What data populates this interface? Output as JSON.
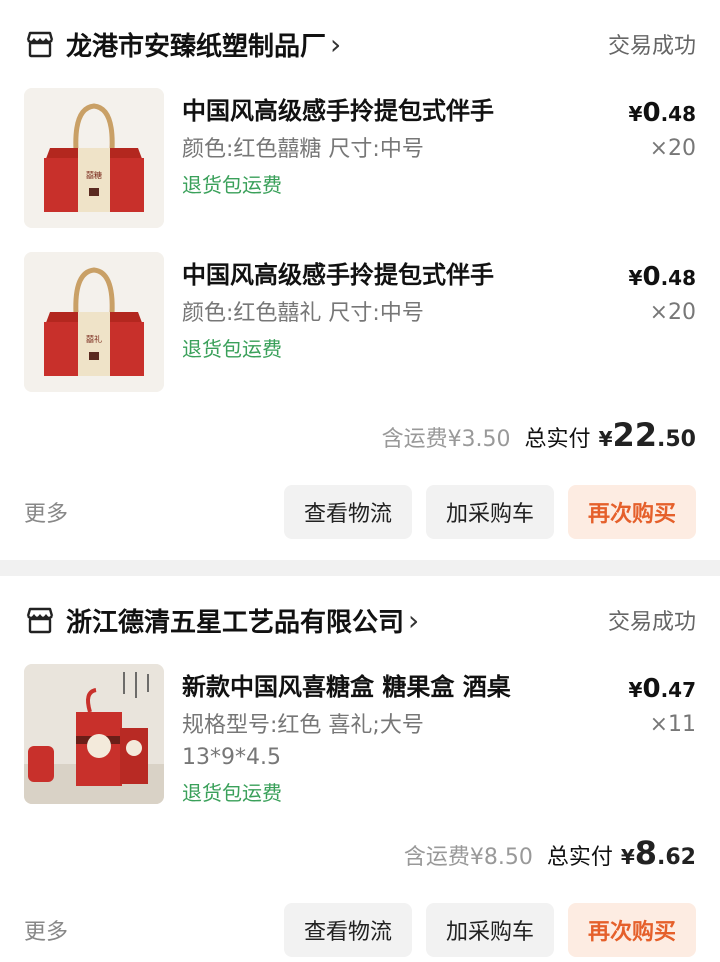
{
  "orders": [
    {
      "shop_name": "龙港市安臻纸塑制品厂",
      "status": "交易成功",
      "items": [
        {
          "title": "中国风高级感手拎提包式伴手",
          "spec": "颜色:红色囍糖 尺寸:中号",
          "return_policy": "退货包运费",
          "price_symbol": "¥",
          "price_int": "0",
          "price_dec": ".48",
          "qty": "×20",
          "label_text": "囍糖"
        },
        {
          "title": "中国风高级感手拎提包式伴手",
          "spec": "颜色:红色囍礼 尺寸:中号",
          "return_policy": "退货包运费",
          "price_symbol": "¥",
          "price_int": "0",
          "price_dec": ".48",
          "qty": "×20",
          "label_text": "囍礼"
        }
      ],
      "shipping": "含运费¥3.50",
      "total_label": "总实付",
      "total_symbol": "¥",
      "total_int": "22",
      "total_dec": ".50",
      "more": "更多",
      "buttons": {
        "logistics": "查看物流",
        "add_cart": "加采购车",
        "buy_again": "再次购买"
      }
    },
    {
      "shop_name": "浙江德清五星工艺品有限公司",
      "status": "交易成功",
      "items": [
        {
          "title": "新款中国风喜糖盒 糖果盒 酒桌",
          "spec": "规格型号:红色 喜礼;大号 13*9*4.5",
          "return_policy": "退货包运费",
          "price_symbol": "¥",
          "price_int": "0",
          "price_dec": ".47",
          "qty": "×11"
        }
      ],
      "shipping": "含运费¥8.50",
      "total_label": "总实付",
      "total_symbol": "¥",
      "total_int": "8",
      "total_dec": ".62",
      "more": "更多",
      "buttons": {
        "logistics": "查看物流",
        "add_cart": "加采购车",
        "buy_again": "再次购买"
      }
    }
  ],
  "colors": {
    "accent": "#e5602b",
    "green": "#3aa05a",
    "product_red": "#c8302b"
  }
}
